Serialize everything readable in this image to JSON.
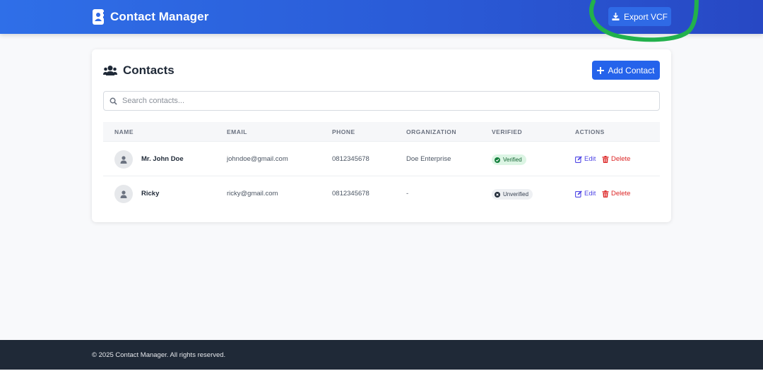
{
  "navbar": {
    "title": "Contact Manager",
    "brand_icon": "address-book-icon",
    "export_label": "Export VCF",
    "export_icon": "download-icon",
    "gradient": [
      "#2f6fe8",
      "#2748c4"
    ]
  },
  "contacts": {
    "title": "Contacts",
    "title_icon": "users-icon",
    "add_label": "Add Contact",
    "add_icon": "plus-icon",
    "search_placeholder": "Search contacts...",
    "columns": [
      "Name",
      "Email",
      "Phone",
      "Organization",
      "Verified",
      "Actions"
    ],
    "rows": [
      {
        "name": "Mr. John Doe",
        "email": "johndoe@gmail.com",
        "phone": "0812345678",
        "organization": "Doe Enterprise",
        "verified": "Verified",
        "edit": "Edit",
        "delete": "Delete"
      },
      {
        "name": "Ricky",
        "email": "ricky@gmail.com",
        "phone": "0812345678",
        "organization": "-",
        "verified": "Unverified",
        "edit": "Edit",
        "delete": "Delete"
      }
    ]
  },
  "footer": {
    "text": "© 2025 Contact Manager. All rights reserved."
  },
  "colors": {
    "primary": "#2563eb",
    "verified_bg": "#dcf5e4",
    "edit": "#4f46e5",
    "delete": "#dc2626",
    "footer_bg": "#1f2937",
    "annotation": "#22b14c"
  }
}
